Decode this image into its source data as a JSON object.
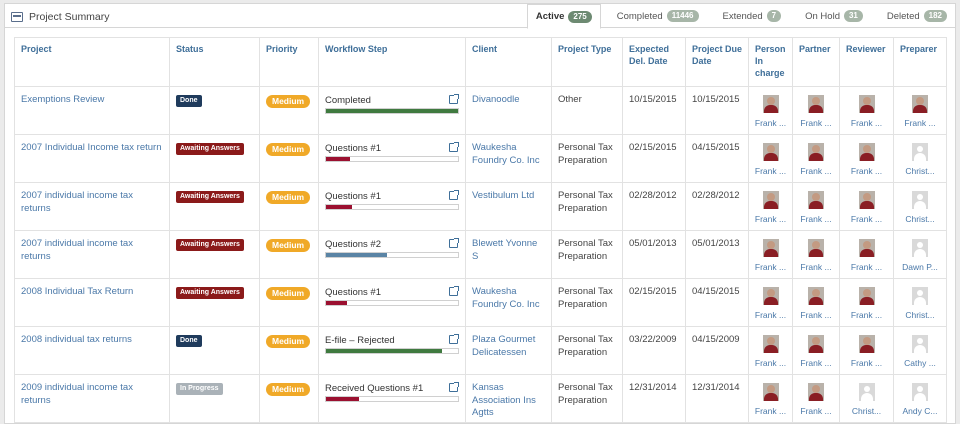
{
  "header": {
    "title": "Project Summary",
    "tabs": [
      {
        "label": "Active",
        "count": "275",
        "active": true
      },
      {
        "label": "Completed",
        "count": "11446"
      },
      {
        "label": "Extended",
        "count": "7"
      },
      {
        "label": "On Hold",
        "count": "31"
      },
      {
        "label": "Deleted",
        "count": "182"
      }
    ]
  },
  "table": {
    "columns": [
      "Project",
      "Status",
      "Priority",
      "Workflow Step",
      "Client",
      "Project Type",
      "Expected Del. Date",
      "Project Due Date",
      "Person In charge",
      "Partner",
      "Reviewer",
      "Preparer"
    ],
    "rows": [
      {
        "project": "Exemptions Review",
        "status": "Done",
        "status_color": "#1f3b5c",
        "priority": "Medium",
        "workflow": "Completed",
        "progress": 1.0,
        "bar_color": "#3f7a3f",
        "client": "Divanoodle",
        "type": "Other",
        "expected": "10/15/2015",
        "due": "10/15/2015",
        "people": [
          {
            "name": "Frank ...",
            "photo": true
          },
          {
            "name": "Frank ...",
            "photo": true
          },
          {
            "name": "Frank ...",
            "photo": true
          },
          {
            "name": "Frank ...",
            "photo": true
          }
        ]
      },
      {
        "project": "2007 Individual Income tax return",
        "status": "Awaiting Answers",
        "status_color": "#8b1a1a",
        "priority": "Medium",
        "workflow": "Questions #1",
        "progress": 0.18,
        "bar_color": "#9b1030",
        "client": "Waukesha Foundry Co. Inc",
        "type": "Personal Tax Preparation",
        "expected": "02/15/2015",
        "due": "04/15/2015",
        "people": [
          {
            "name": "Frank ...",
            "photo": true
          },
          {
            "name": "Frank ...",
            "photo": true
          },
          {
            "name": "Frank ...",
            "photo": true
          },
          {
            "name": "Christ...",
            "photo": false
          }
        ]
      },
      {
        "project": "2007 individual income tax returns",
        "status": "Awaiting Answers",
        "status_color": "#8b1a1a",
        "priority": "Medium",
        "workflow": "Questions #1",
        "progress": 0.2,
        "bar_color": "#9b1030",
        "client": "Vestibulum Ltd",
        "type": "Personal Tax Preparation",
        "expected": "02/28/2012",
        "due": "02/28/2012",
        "people": [
          {
            "name": "Frank ...",
            "photo": true
          },
          {
            "name": "Frank ...",
            "photo": true
          },
          {
            "name": "Frank ...",
            "photo": true
          },
          {
            "name": "Christ...",
            "photo": false
          }
        ]
      },
      {
        "project": "2007 individual income tax returns",
        "status": "Awaiting Answers",
        "status_color": "#8b1a1a",
        "priority": "Medium",
        "workflow": "Questions #2",
        "progress": 0.46,
        "bar_color": "#5a84a5",
        "client": "Blewett Yvonne S",
        "type": "Personal Tax Preparation",
        "expected": "05/01/2013",
        "due": "05/01/2013",
        "people": [
          {
            "name": "Frank ...",
            "photo": true
          },
          {
            "name": "Frank ...",
            "photo": true
          },
          {
            "name": "Frank ...",
            "photo": true
          },
          {
            "name": "Dawn P...",
            "photo": false
          }
        ]
      },
      {
        "project": "2008 Individual Tax Return",
        "status": "Awaiting Answers",
        "status_color": "#8b1a1a",
        "priority": "Medium",
        "workflow": "Questions #1",
        "progress": 0.16,
        "bar_color": "#9b1030",
        "client": "Waukesha Foundry Co. Inc",
        "type": "Personal Tax Preparation",
        "expected": "02/15/2015",
        "due": "04/15/2015",
        "people": [
          {
            "name": "Frank ...",
            "photo": true
          },
          {
            "name": "Frank ...",
            "photo": true
          },
          {
            "name": "Frank ...",
            "photo": true
          },
          {
            "name": "Christ...",
            "photo": false
          }
        ]
      },
      {
        "project": "2008 individual tax returns",
        "status": "Done",
        "status_color": "#1f3b5c",
        "priority": "Medium",
        "workflow": "E-file – Rejected",
        "progress": 0.88,
        "bar_color": "#3f7a3f",
        "client": "Plaza Gourmet Delicatessen",
        "type": "Personal Tax Preparation",
        "expected": "03/22/2009",
        "due": "04/15/2009",
        "people": [
          {
            "name": "Frank ...",
            "photo": true
          },
          {
            "name": "Frank ...",
            "photo": true
          },
          {
            "name": "Frank ...",
            "photo": true
          },
          {
            "name": "Cathy ...",
            "photo": false
          }
        ]
      },
      {
        "project": "2009 individual income tax returns",
        "status": "In Progress",
        "status_color": "#aab2b8",
        "priority": "Medium",
        "workflow": "Received Questions #1",
        "progress": 0.25,
        "bar_color": "#9b1030",
        "client": "Kansas Association Ins Agtts",
        "type": "Personal Tax Preparation",
        "expected": "12/31/2014",
        "due": "12/31/2014",
        "people": [
          {
            "name": "Frank ...",
            "photo": true
          },
          {
            "name": "Frank ...",
            "photo": true
          },
          {
            "name": "Christ...",
            "photo": false
          },
          {
            "name": "Andy C...",
            "photo": false
          }
        ]
      }
    ]
  }
}
